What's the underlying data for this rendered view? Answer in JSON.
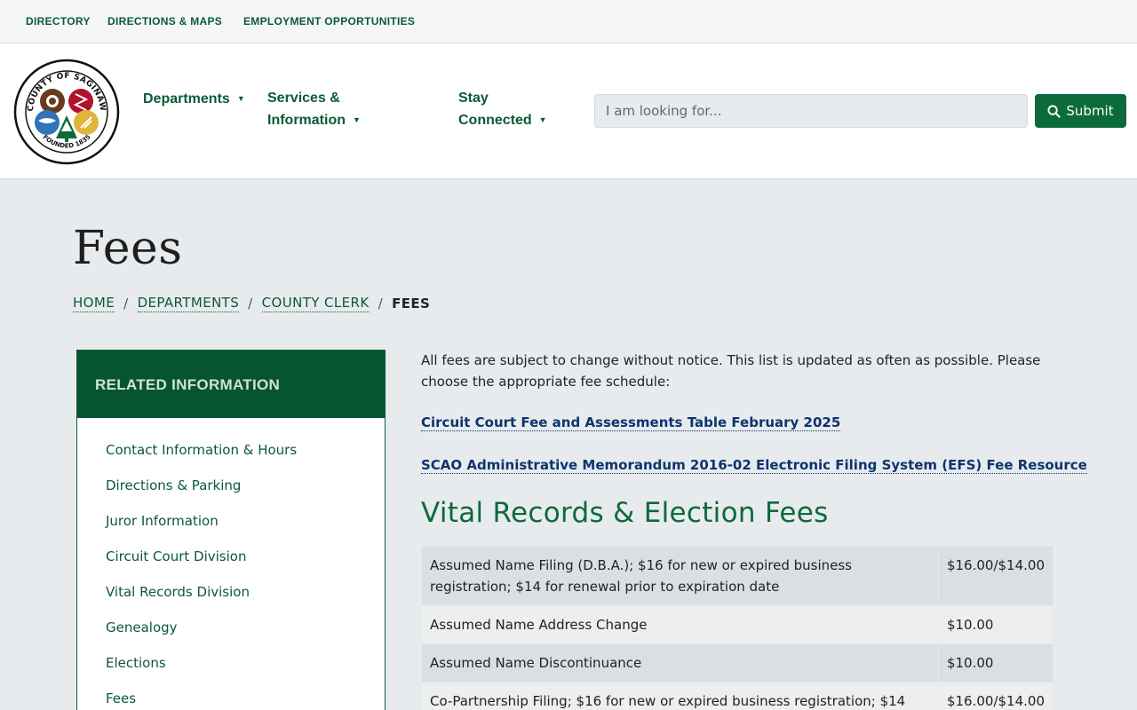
{
  "utility_nav": [
    {
      "label": "DIRECTORY"
    },
    {
      "label": "DIRECTIONS & MAPS"
    },
    {
      "label": "EMPLOYMENT OPPORTUNITIES"
    }
  ],
  "logo": {
    "ring_text_top": "COUNTY OF SAGINAW",
    "ring_text_bottom": "FOUNDED 1835"
  },
  "main_nav": [
    {
      "label_line1": "Departments",
      "label_line2": ""
    },
    {
      "label_line1": "Services &",
      "label_line2": "Information"
    },
    {
      "label_line1": "Stay",
      "label_line2": "Connected"
    }
  ],
  "search": {
    "placeholder": "I am looking for...",
    "submit_label": "Submit"
  },
  "page": {
    "title": "Fees",
    "breadcrumb": [
      "HOME",
      "DEPARTMENTS",
      "COUNTY CLERK"
    ],
    "breadcrumb_current": "FEES"
  },
  "sidebar": {
    "heading": "RELATED INFORMATION",
    "items": [
      "Contact Information & Hours",
      "Directions & Parking",
      "Juror Information",
      "Circuit Court Division",
      "Vital Records Division",
      "Genealogy",
      "Elections",
      "Fees"
    ]
  },
  "content": {
    "intro": "All fees are subject to change without notice. This list is updated as often as possible. Please choose the appropriate fee schedule:",
    "links": [
      "Circuit Court Fee and Assessments Table February 2025",
      "SCAO Administrative Memorandum 2016-02 Electronic Filing System (EFS) Fee Resource"
    ],
    "section_title": "Vital Records & Election Fees",
    "fees": [
      {
        "desc": "Assumed Name Filing (D.B.A.); $16 for new or expired business registration; $14 for renewal prior to expiration date",
        "amount": "$16.00/$14.00"
      },
      {
        "desc": "Assumed Name Address Change",
        "amount": "$10.00"
      },
      {
        "desc": "Assumed Name Discontinuance",
        "amount": "$10.00"
      },
      {
        "desc": "Co-Partnership Filing; $16 for new or expired business registration; $14",
        "amount": "$16.00/$14.00"
      }
    ]
  },
  "colors": {
    "brand_green": "#0c5a36",
    "sidebar_head": "#075431",
    "link_blue": "#0c3470"
  }
}
